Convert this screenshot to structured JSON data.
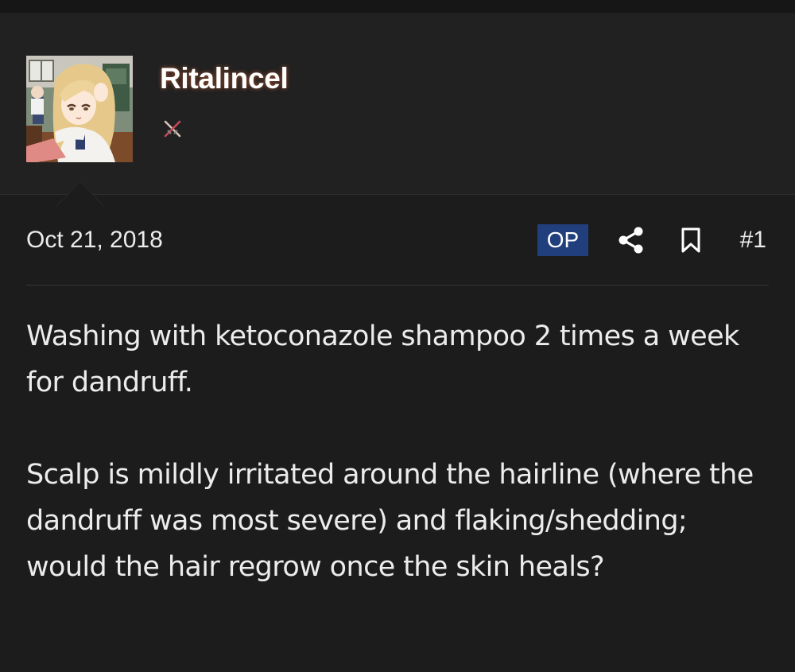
{
  "post": {
    "author": {
      "username": "Ritalincel",
      "avatar_icon": "anime-avatar-icon",
      "badge_icon": "crossed-swords-icon"
    },
    "date": "Oct 21, 2018",
    "op_label": "OP",
    "share_icon": "share-icon",
    "bookmark_icon": "bookmark-icon",
    "post_number": "#1",
    "body": {
      "paragraph_1": "Washing with ketoconazole shampoo 2 times a week for dandruff.",
      "paragraph_2": "Scalp is mildly irritated around the hairline (where the dandruff was most severe) and flaking/shedding; would the hair regrow once the skin heals?"
    }
  },
  "colors": {
    "background": "#1c1c1c",
    "header_background": "#212121",
    "op_badge": "#203f7c",
    "text": "#ececec"
  }
}
